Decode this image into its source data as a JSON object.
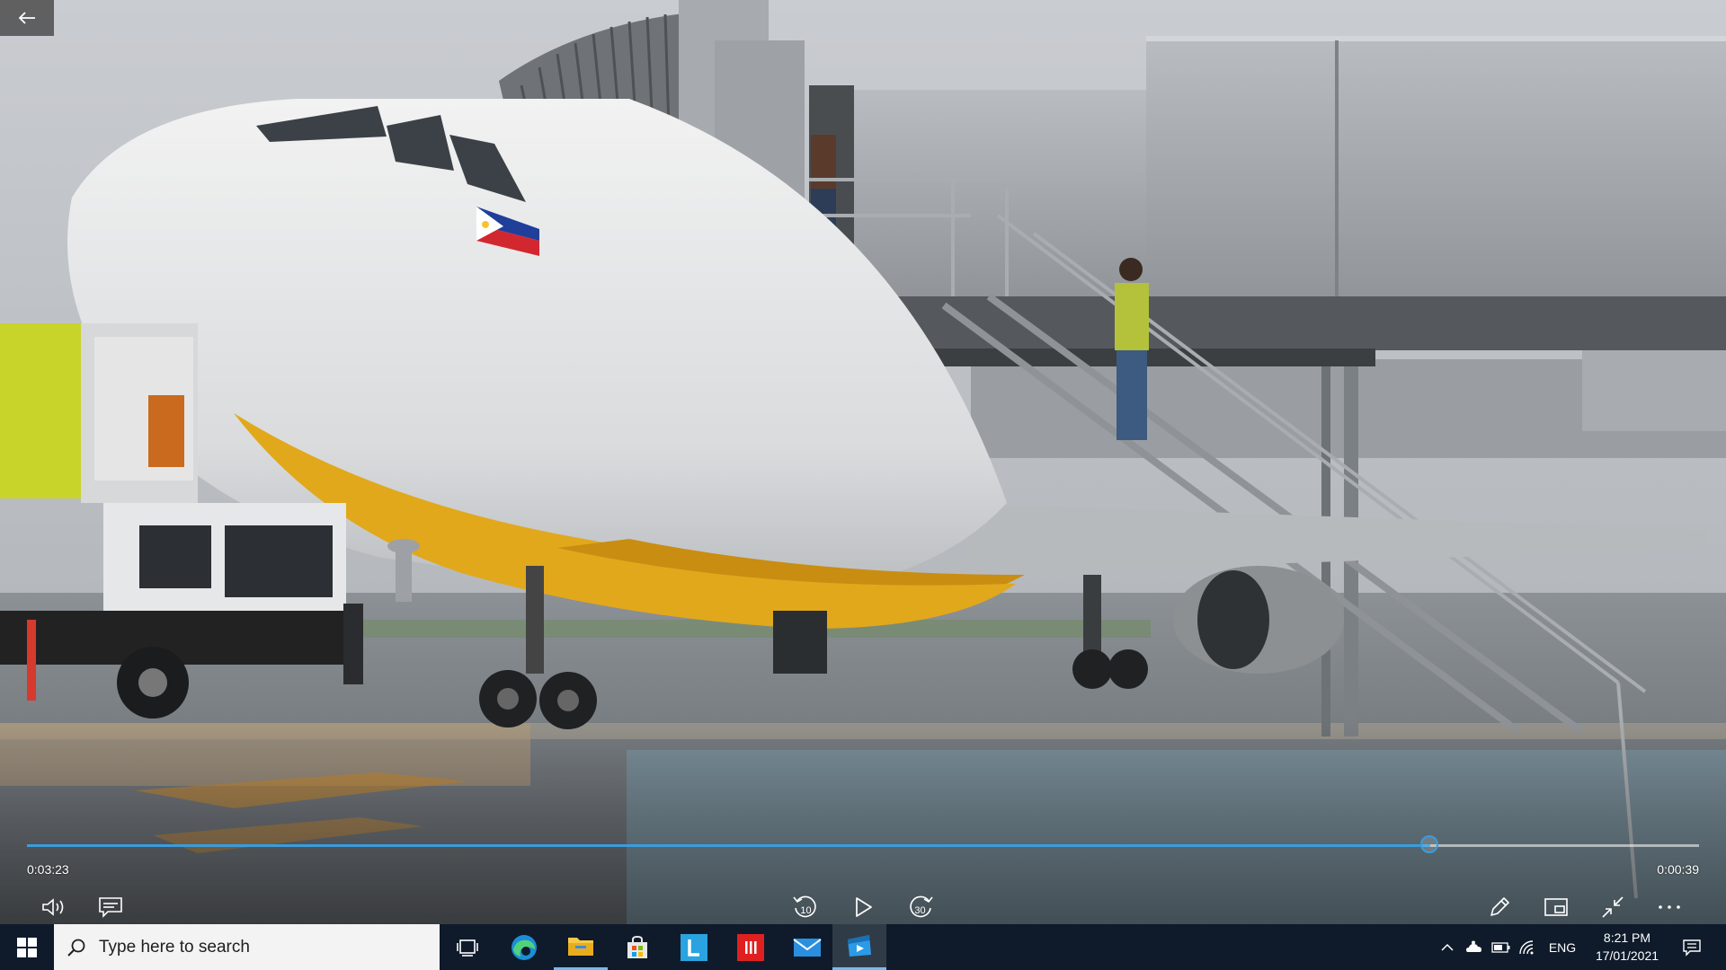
{
  "player": {
    "elapsed_time": "0:03:23",
    "remaining_time": "0:00:39",
    "progress": 0.839,
    "accent_color": "#3b9cdc",
    "buttons": {
      "back": "back-arrow-icon",
      "volume": "volume-icon",
      "captions": "captions-icon",
      "skip_back": "10",
      "play": "play-icon",
      "skip_forward": "30",
      "edit": "pencil-icon",
      "mini_view": "mini-view-icon",
      "exit_fullscreen": "exit-fullscreen-icon",
      "more": "more-icon"
    }
  },
  "taskbar": {
    "search_placeholder": "Type here to search",
    "apps": [
      "task-view",
      "edge",
      "file-explorer",
      "microsoft-store",
      "l-app",
      "red-app",
      "mail",
      "video-player"
    ],
    "tray": {
      "language": "ENG",
      "time": "8:21 PM",
      "date": "17/01/2021"
    }
  }
}
